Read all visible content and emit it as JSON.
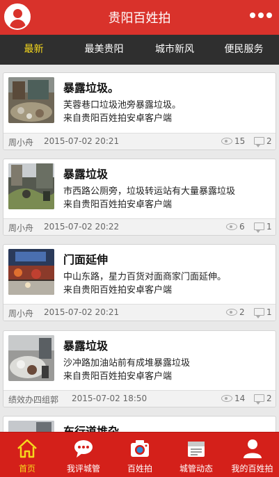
{
  "header": {
    "title": "贵阳百姓拍"
  },
  "tabs": [
    {
      "label": "最新"
    },
    {
      "label": "最美贵阳"
    },
    {
      "label": "城市新风"
    },
    {
      "label": "便民服务"
    }
  ],
  "posts": [
    {
      "title": "暴露垃圾。",
      "desc_line1": "芙蓉巷口垃圾池旁暴露垃圾。",
      "desc_line2": "来自贵阳百姓拍安卓客户端",
      "author": "周小舟",
      "time": "2015-07-02 20:21",
      "views": "15",
      "comments": "2"
    },
    {
      "title": "暴露垃圾",
      "desc_line1": "市西路公厕旁，垃圾转运站有大量暴露垃圾",
      "desc_line2": "来自贵阳百姓拍安卓客户端",
      "author": "周小舟",
      "time": "2015-07-02 20:22",
      "views": "6",
      "comments": "1"
    },
    {
      "title": "门面延伸",
      "desc_line1": "中山东路，星力百货对面商家门面延伸。",
      "desc_line2": "来自贵阳百姓拍安卓客户端",
      "author": "周小舟",
      "time": "2015-07-02 20:21",
      "views": "2",
      "comments": "1"
    },
    {
      "title": "暴露垃圾",
      "desc_line1": "沙冲路加油站前有成堆暴露垃圾",
      "desc_line2": "来自贵阳百姓拍安卓客户端",
      "author": "绩效办四组郭",
      "time": "2015-07-02 18:50",
      "views": "14",
      "comments": "2"
    },
    {
      "title": "车行道堆杂"
    }
  ],
  "bottom_nav": [
    {
      "label": "首页",
      "icon": "home-icon"
    },
    {
      "label": "我评城管",
      "icon": "chat-bubble-icon"
    },
    {
      "label": "百姓拍",
      "icon": "camera-icon"
    },
    {
      "label": "城管动态",
      "icon": "news-icon"
    },
    {
      "label": "我的百姓拍",
      "icon": "user-icon"
    }
  ],
  "colors": {
    "brand_red": "#d9322b",
    "tab_bar": "#2f2f2f",
    "active_yellow": "#f6d81d"
  }
}
